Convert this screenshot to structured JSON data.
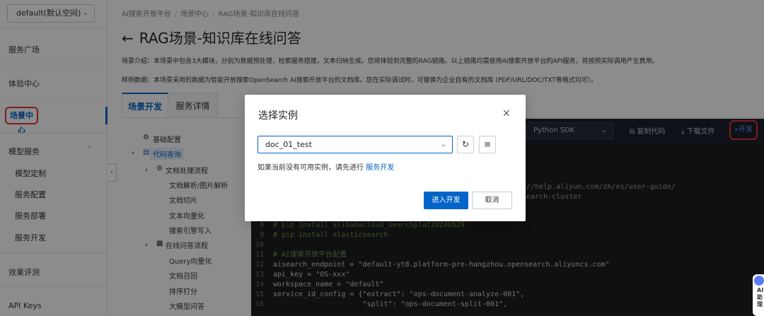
{
  "sidebar": {
    "workspace": "default(默认空间)",
    "items": {
      "service_square": "服务广场",
      "experience_center": "体验中心",
      "scene_center": "场景中心",
      "model_service": "模型服务",
      "model_custom": "模型定制",
      "service_config": "服务配置",
      "service_deploy": "服务部署",
      "service_dev": "服务开发",
      "effect_eval": "效果评测",
      "api_keys": "API Keys"
    }
  },
  "header": {
    "breadcrumb": [
      "AI搜索开放平台",
      "场景中心",
      "RAG场景-知识库在线问答"
    ],
    "title": "RAG场景-知识库在线问答",
    "desc1": "场景介绍：本场景中包含3大模块，分别为数据预处理，检索服务搭建，文本归纳生成。您将体验到完整的RAG链路。以上链路均需使用AI搜索开放平台的API服务，将按照实际调用产生费用。",
    "desc2": "样例数据：本场景采用的数据为智能开放搜索OpenSearch AI搜索开放平台的文档库。您在实际调试时，可替换为企业自有的文档库 (PDF/URL/DOC/TXT等格式均可）。"
  },
  "tabs": {
    "dev": "场景开发",
    "detail": "服务详情"
  },
  "tree": {
    "basic_config": "基础配置",
    "code_query": "代码查询",
    "doc_flow": "文档处理流程",
    "doc_parse": "文档解析/图片解析",
    "doc_split": "文档切片",
    "text_embed": "文本向量化",
    "engine_write": "搜索引擎写入",
    "online_flow": "在线问答流程",
    "query_embed": "Query向量化",
    "doc_recall": "文档召回",
    "rank": "排序打分",
    "llm": "大模型问答"
  },
  "code_toolbar": {
    "sdk": "Python SDK",
    "copy": "复制代码",
    "download": "下载文件",
    "develop": "开发"
  },
  "code": {
    "url_frag1": "://help.aliyun.com/zh/es/user-guide/",
    "url_frag2": "search-cluster",
    "lines": [
      {
        "n": "8",
        "text": "# pip install alibabacloud_searchplat20240529",
        "cls": "c-comment"
      },
      {
        "n": "9",
        "text": "# pip install elasticsearch",
        "cls": "c-comment"
      },
      {
        "n": "10",
        "text": "",
        "cls": "c-plain"
      },
      {
        "n": "11",
        "text": "# AI搜索开放平台配置",
        "cls": "c-comment"
      },
      {
        "n": "12",
        "text": "aisearch_endpoint = \"default-yt8.platform-pre-hangzhou.opensearch.aliyuncs.com\"",
        "cls": "c-plain"
      },
      {
        "n": "13",
        "text": "api_key = \"OS-xxx\"",
        "cls": "c-plain"
      },
      {
        "n": "14",
        "text": "workspace_name = \"default\"",
        "cls": "c-plain"
      },
      {
        "n": "15",
        "text": "service_id_config = {\"extract\": \"ops-document-analyze-001\",",
        "cls": "c-plain"
      },
      {
        "n": "16",
        "text": "                     \"split\": \"ops-document-split-001\",",
        "cls": "c-plain"
      }
    ]
  },
  "modal": {
    "title": "选择实例",
    "instance": "doc_01_test",
    "hint": "如果当前没有可用实例，请先进行",
    "hint_link": "服务开发",
    "confirm": "进入开发",
    "cancel": "取消"
  },
  "assistant": {
    "text": "AI助理"
  }
}
